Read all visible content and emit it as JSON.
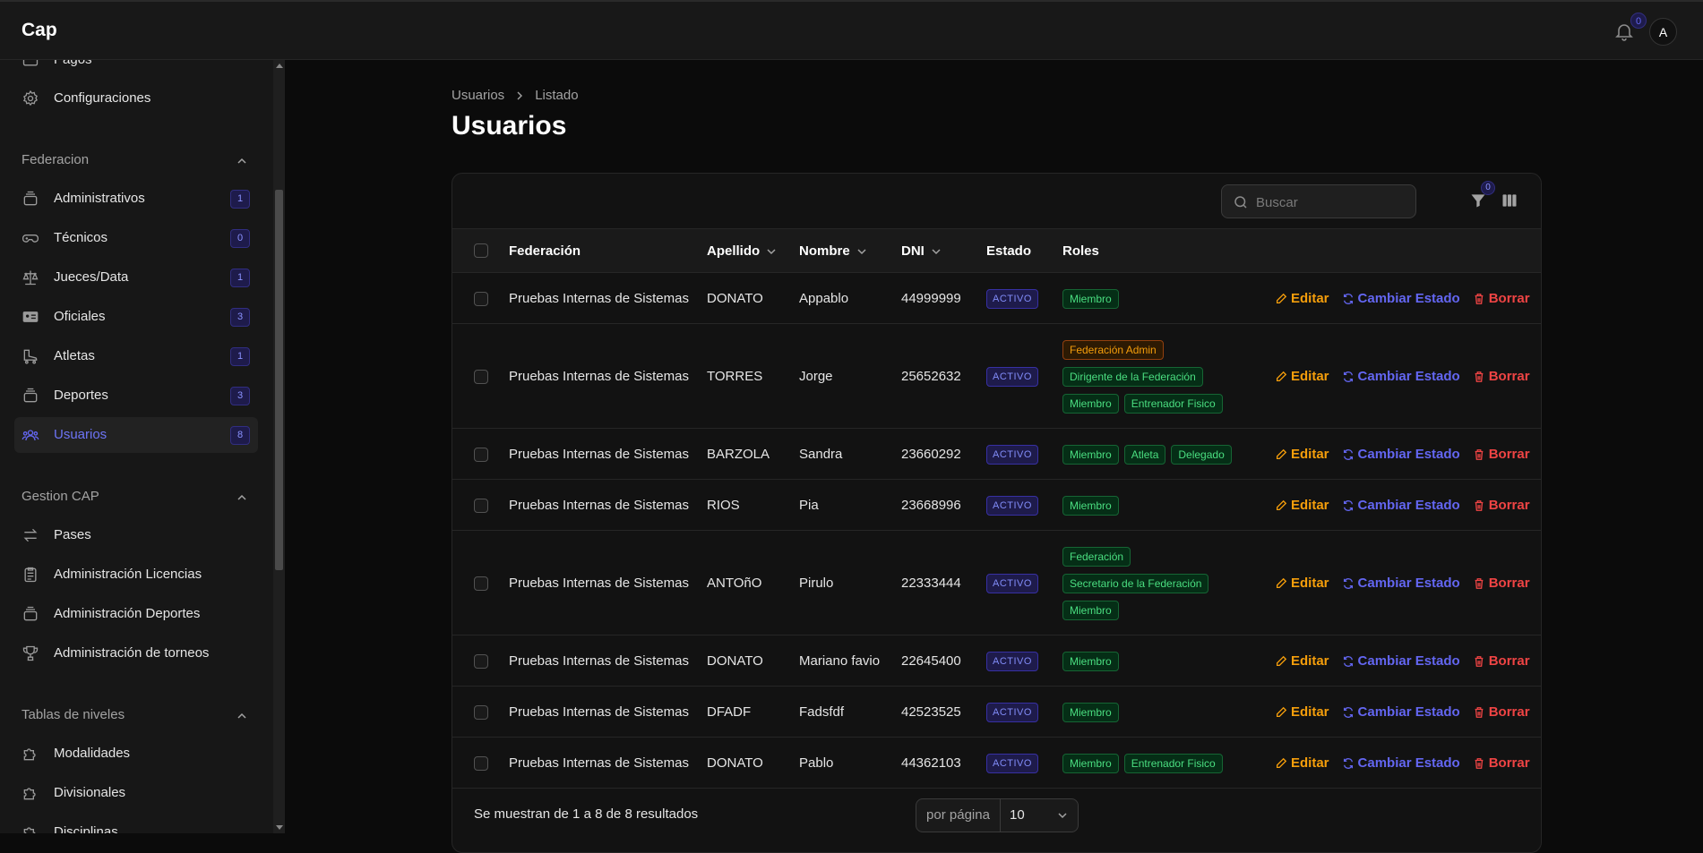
{
  "app": {
    "brand": "Cap",
    "notifications_count": "0",
    "avatar_initial": "A"
  },
  "sidebar": {
    "top_items": [
      {
        "label": "Pagos",
        "icon": "card-icon"
      },
      {
        "label": "Configuraciones",
        "icon": "gear-icon"
      }
    ],
    "groups": [
      {
        "label": "Federacion",
        "items": [
          {
            "label": "Administrativos",
            "count": "1",
            "icon": "stack-icon"
          },
          {
            "label": "Técnicos",
            "count": "0",
            "icon": "gamepad-icon"
          },
          {
            "label": "Jueces/Data",
            "count": "1",
            "icon": "scale-icon"
          },
          {
            "label": "Oficiales",
            "count": "3",
            "icon": "id-card-icon"
          },
          {
            "label": "Atletas",
            "count": "1",
            "icon": "skate-icon"
          },
          {
            "label": "Deportes",
            "count": "3",
            "icon": "stack-icon"
          },
          {
            "label": "Usuarios",
            "count": "8",
            "icon": "users-icon",
            "active": true
          }
        ]
      },
      {
        "label": "Gestion CAP",
        "items": [
          {
            "label": "Pases",
            "icon": "arrows-icon"
          },
          {
            "label": "Administración Licencias",
            "icon": "clipboard-icon"
          },
          {
            "label": "Administración Deportes",
            "icon": "stack-icon"
          },
          {
            "label": "Administración de torneos",
            "icon": "trophy-icon"
          }
        ]
      },
      {
        "label": "Tablas de niveles",
        "items": [
          {
            "label": "Modalidades",
            "icon": "puzzle-icon"
          },
          {
            "label": "Divisionales",
            "icon": "puzzle-icon"
          },
          {
            "label": "Disciplinas",
            "icon": "puzzle-icon"
          }
        ]
      }
    ]
  },
  "breadcrumb": {
    "parent": "Usuarios",
    "current": "Listado"
  },
  "page_title": "Usuarios",
  "search": {
    "placeholder": "Buscar",
    "value": ""
  },
  "filter_count": "0",
  "table": {
    "headers": {
      "federacion": "Federación",
      "apellido": "Apellido",
      "nombre": "Nombre",
      "dni": "DNI",
      "estado": "Estado",
      "roles": "Roles"
    },
    "rows": [
      {
        "federacion": "Pruebas Internas de Sistemas",
        "apellido": "DONATO",
        "nombre": "Appablo",
        "dni": "44999999",
        "estado": "ACTIVO",
        "roles": [
          [
            "Miembro"
          ]
        ]
      },
      {
        "federacion": "Pruebas Internas de Sistemas",
        "apellido": "TORRES",
        "nombre": "Jorge",
        "dni": "25652632",
        "estado": "ACTIVO",
        "roles": [
          [
            "Federación Admin"
          ],
          [
            "Dirigente de la Federación"
          ],
          [
            "Miembro",
            "Entrenador Fisico"
          ]
        ]
      },
      {
        "federacion": "Pruebas Internas de Sistemas",
        "apellido": "BARZOLA",
        "nombre": "Sandra",
        "dni": "23660292",
        "estado": "ACTIVO",
        "roles": [
          [
            "Miembro",
            "Atleta",
            "Delegado"
          ]
        ]
      },
      {
        "federacion": "Pruebas Internas de Sistemas",
        "apellido": "RIOS",
        "nombre": "Pia",
        "dni": "23668996",
        "estado": "ACTIVO",
        "roles": [
          [
            "Miembro"
          ]
        ]
      },
      {
        "federacion": "Pruebas Internas de Sistemas",
        "apellido": "ANTOñO",
        "nombre": "Pirulo",
        "dni": "22333444",
        "estado": "ACTIVO",
        "roles": [
          [
            "Federación"
          ],
          [
            "Secretario de la Federación"
          ],
          [
            "Miembro"
          ]
        ]
      },
      {
        "federacion": "Pruebas Internas de Sistemas",
        "apellido": "DONATO",
        "nombre": "Mariano favio",
        "dni": "22645400",
        "estado": "ACTIVO",
        "roles": [
          [
            "Miembro"
          ]
        ]
      },
      {
        "federacion": "Pruebas Internas de Sistemas",
        "apellido": "DFADF",
        "nombre": "Fadsfdf",
        "dni": "42523525",
        "estado": "ACTIVO",
        "roles": [
          [
            "Miembro"
          ]
        ]
      },
      {
        "federacion": "Pruebas Internas de Sistemas",
        "apellido": "DONATO",
        "nombre": "Pablo",
        "dni": "44362103",
        "estado": "ACTIVO",
        "roles": [
          [
            "Miembro",
            "Entrenador Fisico"
          ]
        ]
      }
    ],
    "actions": {
      "edit": "Editar",
      "status": "Cambiar Estado",
      "delete": "Borrar"
    }
  },
  "pagination": {
    "summary": "Se muestran de 1 a 8 de 8 resultados",
    "per_page_label": "por página",
    "per_page_value": "10"
  },
  "colors": {
    "accent": "#6366f1",
    "edit": "#f59e0b",
    "delete": "#ef4444",
    "role_green": "#4ade80",
    "role_admin": "#f59e0b"
  }
}
